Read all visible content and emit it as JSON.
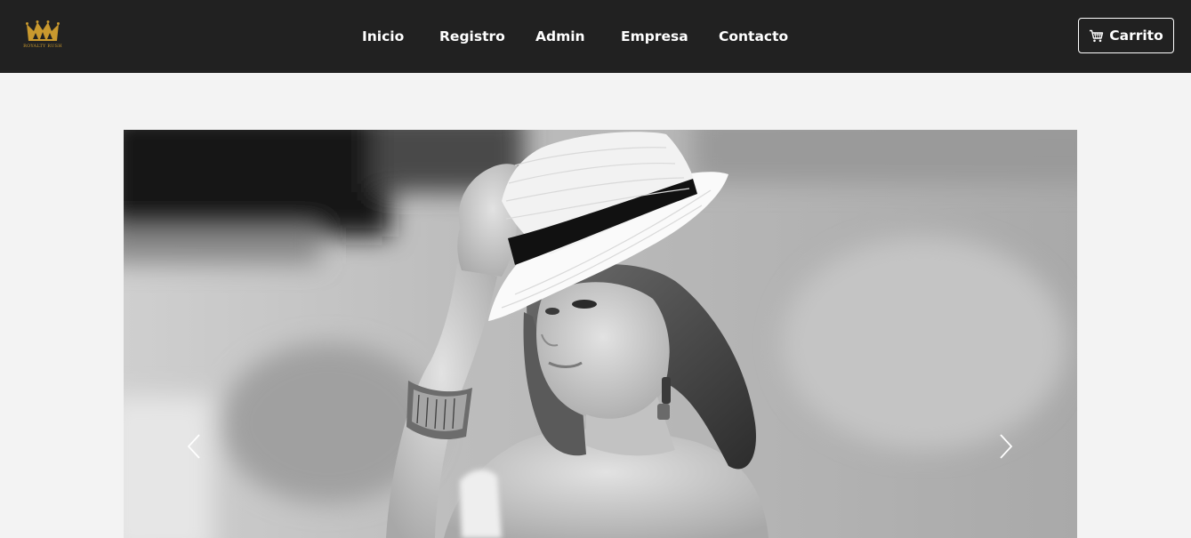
{
  "brand": {
    "logo_icon": "crown-icon",
    "logo_text": "ROYALTY RUSH",
    "accent_color": "#c9992e"
  },
  "nav": {
    "links": [
      {
        "label": "Inicio"
      },
      {
        "label": "Registro"
      },
      {
        "label": "Admin"
      },
      {
        "label": "Empresa"
      },
      {
        "label": "Contacto"
      }
    ],
    "background": "#212121",
    "text_color": "#ffffff"
  },
  "cart": {
    "label": "Carrito",
    "icon": "cart-icon"
  },
  "carousel": {
    "image_subject": "black-and-white photo of woman wearing white fedora hat",
    "prev_icon": "chevron-left-icon",
    "next_icon": "chevron-right-icon"
  },
  "page": {
    "background": "#f3f3f3"
  }
}
